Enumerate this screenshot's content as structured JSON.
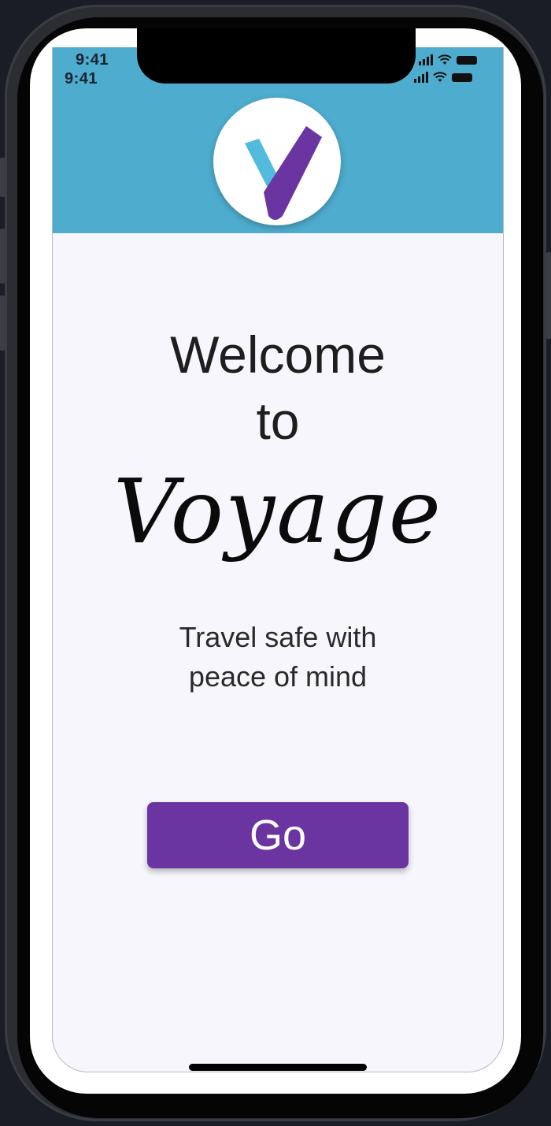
{
  "status_bar": {
    "time_primary": "9:41",
    "time_secondary": "9:41"
  },
  "header": {
    "logo_icon": "voyage-v-logo",
    "background_color": "#4eacce"
  },
  "welcome": {
    "line1": "Welcome",
    "line2": "to",
    "brand": "Voyage"
  },
  "tagline": {
    "line1": "Travel safe with",
    "line2": "peace of mind"
  },
  "actions": {
    "go_label": "Go",
    "button_color": "#6b35a1"
  }
}
